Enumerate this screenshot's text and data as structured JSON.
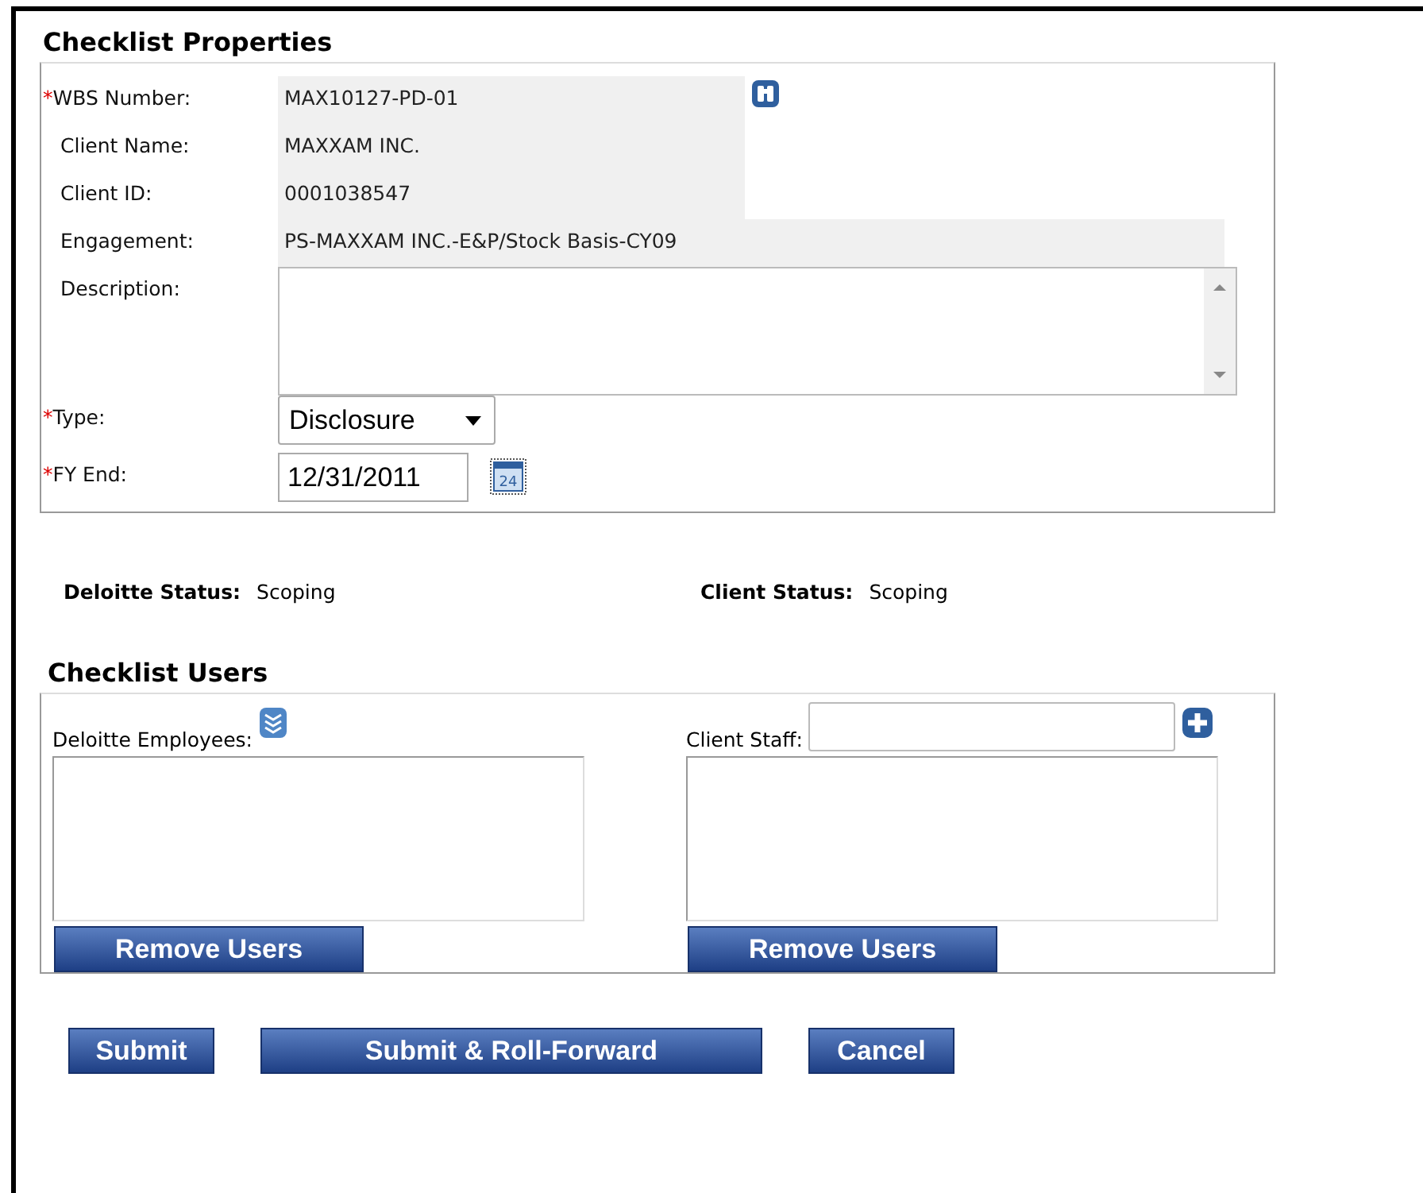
{
  "properties": {
    "title": "Checklist Properties",
    "fields": [
      {
        "kind": "lookup",
        "required_mark": "*",
        "label": "WBS Number:",
        "value": "MAX10127-PD-01"
      },
      {
        "kind": "readonly",
        "label": "Client Name:",
        "value": "MAXXAM INC."
      },
      {
        "kind": "readonly",
        "label": "Client ID:",
        "value": "0001038547"
      },
      {
        "kind": "readonly_wide",
        "label": "Engagement:",
        "value": "PS-MAXXAM INC.-E&P/Stock Basis-CY09"
      },
      {
        "kind": "textarea",
        "label": "Description:"
      },
      {
        "kind": "select",
        "required_mark": "*",
        "label": "Type:",
        "value": "Disclosure"
      },
      {
        "kind": "date",
        "required_mark": "*",
        "label": "FY End:",
        "value": "12/31/2011",
        "calendar_day": "24"
      }
    ]
  },
  "statuses": [
    {
      "label": "Deloitte Status:",
      "value": "Scoping"
    },
    {
      "label": "Client Status:",
      "value": "Scoping"
    }
  ],
  "users": {
    "title": "Checklist Users",
    "panels": [
      {
        "kind": "employees",
        "label": "Deloitte Employees:",
        "button": "Remove Users"
      },
      {
        "kind": "staff",
        "label": "Client Staff:",
        "button": "Remove Users"
      }
    ]
  },
  "actions": [
    "Submit",
    "Submit & Roll-Forward",
    "Cancel"
  ]
}
